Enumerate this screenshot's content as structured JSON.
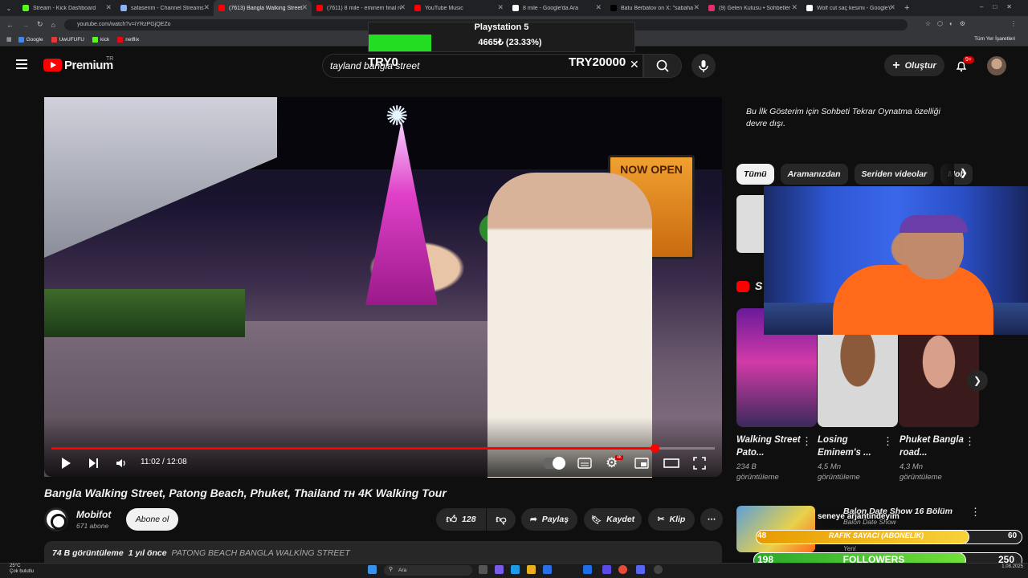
{
  "tabs": [
    {
      "title": "Stream - Kick Dashboard",
      "color": "#53fc18"
    },
    {
      "title": "safaserim - Channel Streams or...",
      "color": "#8ab4f8"
    },
    {
      "title": "(7613) Bangla Walking Street, P...",
      "color": "#ff0000",
      "active": true
    },
    {
      "title": "(7611) 8 mile - eminem final ro...",
      "color": "#ff0000"
    },
    {
      "title": "YouTube Music",
      "color": "#ff0000"
    },
    {
      "title": "8 mile - Google'da Ara",
      "color": "#ffffff"
    },
    {
      "title": "Batu Berbatov on X: \"sabaha ka...",
      "color": "#000000"
    },
    {
      "title": "(9) Gelen Kutusu • Sohbetler",
      "color": "#e1306c"
    },
    {
      "title": "Wolf cut saç kesimi - Google'da...",
      "color": "#ffffff"
    }
  ],
  "url": "youtube.com/watch?v=iYRzPGjQEZo",
  "bookmarks": [
    {
      "label": "Google",
      "color": "#4285f4"
    },
    {
      "label": "UwUFUFU",
      "color": "#e53935"
    },
    {
      "label": "kick",
      "color": "#53fc18"
    },
    {
      "label": "netflix",
      "color": "#e50914"
    }
  ],
  "bookmarks_all": "Tüm Yer İşaretleri",
  "overlay": {
    "title": "Playstation 5",
    "amount": "4665₺ (23.33%)",
    "progress": 0.2333,
    "goal_left": "TRY0",
    "goal_right": "TRY20000"
  },
  "header": {
    "logo": "Premium",
    "logo_region": "TR",
    "search_value": "tayland bangla street",
    "create_label": "Oluştur",
    "notifications": "9+"
  },
  "player": {
    "time": "11:02 / 12:08",
    "progress": 0.909,
    "sign_text": "NOW OPEN"
  },
  "video": {
    "title": "Bangla Walking Street, Patong Beach, Phuket, Thailand ᴛʜ 4K Walking Tour",
    "channel": "Mobifot",
    "subscribers": "671 abone",
    "subscribe_label": "Abone ol",
    "likes": "128",
    "share_label": "Paylaş",
    "save_label": "Kaydet",
    "clip_label": "Klip",
    "views": "74 B görüntüleme",
    "ago": "1 yıl önce",
    "tags": "PATONG BEACH BANGLA WALKİNG STREET"
  },
  "sidebar": {
    "premiere_note": "Bu İlk Gösterim için Sohbeti Tekrar Oynatma özelliği devre dışı.",
    "chips": [
      "Tümü",
      "Aramanızdan",
      "Seriden videolar",
      "Mob"
    ],
    "shorts_letter": "S",
    "shorts": [
      {
        "title": "Walking Street Pato...",
        "views": "234 B görüntüleme"
      },
      {
        "title": "Losing Eminem's ...",
        "views": "4,5 Mn görüntüleme"
      },
      {
        "title": "Phuket Bangla road...",
        "views": "4,3 Mn görüntüleme"
      }
    ],
    "balon": {
      "title": "Balon Date Show 16 Bölüm",
      "channel": "Balon Date Show",
      "badge": "Yeni"
    }
  },
  "alerts": {
    "chat": "seneye arjantindeyim",
    "sub_left": "48",
    "sub_center": "RAFIK SAYACI (ABONELIK)",
    "sub_right": "60",
    "sub_progress": 0.8,
    "fol_left": "198",
    "fol_center": "FOLLOWERS",
    "fol_right": "250",
    "fol_progress": 0.792
  },
  "taskbar": {
    "temp": "25°C",
    "weather": "Çok bulutlu",
    "search": "Ara",
    "date": "1.08.2025"
  }
}
